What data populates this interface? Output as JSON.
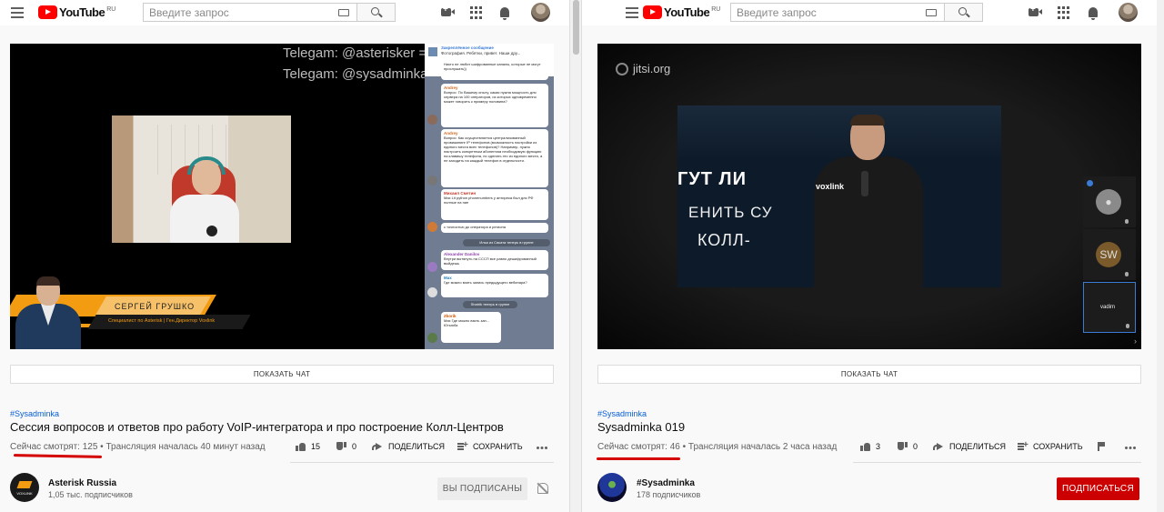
{
  "common": {
    "logo_text": "YouTube",
    "logo_region": "RU",
    "search_placeholder": "Введите запрос",
    "show_chat_label": "ПОКАЗАТЬ ЧАТ",
    "like_icon": "thumb-up-icon",
    "share_label": "ПОДЕЛИТЬСЯ",
    "save_label": "СОХРАНИТЬ"
  },
  "left": {
    "video_overlay": {
      "telegram_line1": "Telegam: @asterisker =",
      "telegram_line2": "Telegam: @sysadminka",
      "lower_third_name": "СЕРГЕЙ ГРУШКО",
      "lower_third_role": "Специалист по Asterisk | Ген.Директор Voxlink"
    },
    "telegram_chat": {
      "pinned_title": "Закреплённое сообщение",
      "pinned_text": "Фотография. Ребятки, привет. Наши дру...",
      "messages": [
        {
          "author": "",
          "text": "Никто не любит шифрованные каналы, которые не могут прослушать))",
          "time": "17:35"
        },
        {
          "author": "Andrey",
          "text": "Вопрос: По Вашему опыту, какая нужна мощность для сервера на 100 операторов, из которых одновременно может говорить к примеру половина?",
          "time": "19:30"
        },
        {
          "author": "Andrey",
          "text": "Вопрос: Как осуществляется централизованный провижининг IP телефонов (возможность настройки из единого места всех телефонов)? Например, нужно настроить конкретным абонентам необходимую функцию на клавишу телефона, но сделать это из единого места, а не заходить на каждый телефон в отдельности.",
          "time": "19:30"
        },
        {
          "author": "Михаил Сметин",
          "text": "Max Lit python phonenumbers у антирека был для РФ полные на ние",
          "time": "19:31"
        },
        {
          "author": "",
          "text": "с точностью до оператора и региона",
          "time": "19:31"
        },
        {
          "author": "Alexander Danilov",
          "text": "Внутри вытянуть на СССП все равно дешифрованный выйдешь",
          "time": "19:32"
        },
        {
          "author": "Max",
          "text": "Где можно взять запись предыдущего вебинара?",
          "time": "19:34"
        },
        {
          "author": "Zkorik",
          "text": "Max Где можно взять зап... Ютьюба",
          "time": "19:35"
        }
      ],
      "service_joins": [
        "Илья из Саката теперь в группе",
        "Shatrik теперь в группе"
      ]
    },
    "video_info": {
      "hashtag": "#Sysadminka",
      "title": "Сессия вопросов и ответов про работу VoIP-интегратора и про построение Колл-Центров",
      "viewers_prefix": "Сейчас смотрят: 125",
      "started": " • Трансляция началась 40 минут назад",
      "likes": "15",
      "dislikes": "0"
    },
    "channel": {
      "name": "Asterisk Russia",
      "subscribers": "1,05 тыс. подписчиков",
      "avatar_text": "VOXLINK",
      "subscribe_label": "ВЫ ПОДПИСАНЫ"
    }
  },
  "right": {
    "video_overlay": {
      "jitsi_label": "jitsi.org",
      "slide_line1": "ГУТ ЛИ",
      "slide_line2": "ЕНИТЬ СУ",
      "slide_line3": "КОЛЛ-",
      "voxlink_logo": "voxlink",
      "tile_sw": "SW",
      "tile_vadim": "vadim"
    },
    "video_info": {
      "hashtag": "#Sysadminka",
      "title": "Sysadminka 019",
      "viewers_prefix": "Сейчас смотрят: 46",
      "started": " • Трансляция началась 2 часа назад",
      "likes": "3",
      "dislikes": "0"
    },
    "channel": {
      "name": "#Sysadminka",
      "subscribers": "178 подписчиков",
      "subscribe_label": "ПОДПИСАТЬСЯ"
    }
  },
  "colors": {
    "brand_red": "#ff0000",
    "subscribe_red": "#cc0000",
    "link_blue": "#065fd4",
    "underline_red": "#d50000"
  }
}
